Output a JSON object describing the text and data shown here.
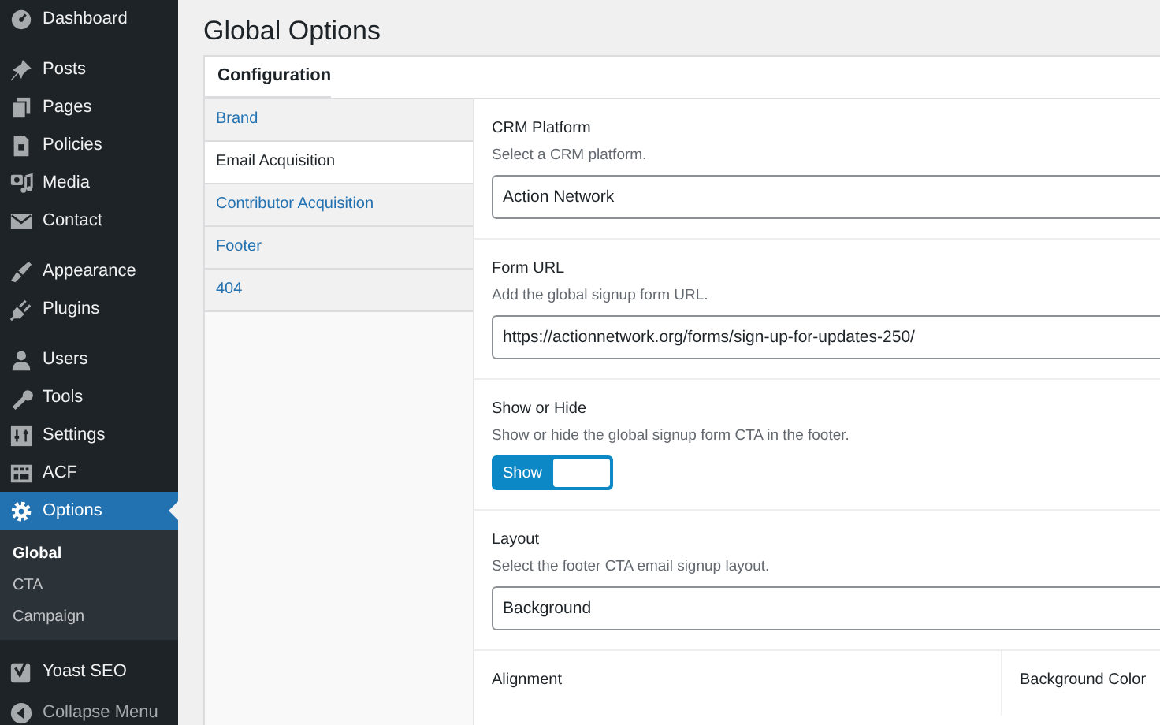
{
  "sidebar": {
    "groups": [
      [
        {
          "label": "Dashboard",
          "selected": false
        }
      ],
      [
        {
          "label": "Posts",
          "selected": false
        },
        {
          "label": "Pages",
          "selected": false
        },
        {
          "label": "Policies",
          "selected": false
        },
        {
          "label": "Media",
          "selected": false
        },
        {
          "label": "Contact",
          "selected": false
        }
      ],
      [
        {
          "label": "Appearance",
          "selected": false
        },
        {
          "label": "Plugins",
          "selected": false
        }
      ],
      [
        {
          "label": "Users",
          "selected": false
        },
        {
          "label": "Tools",
          "selected": false
        },
        {
          "label": "Settings",
          "selected": false
        },
        {
          "label": "ACF",
          "selected": false
        },
        {
          "label": "Options",
          "selected": true,
          "children": [
            {
              "label": "Global",
              "selected": true
            },
            {
              "label": "CTA",
              "selected": false
            },
            {
              "label": "Campaign",
              "selected": false
            }
          ]
        }
      ],
      [
        {
          "label": "Yoast SEO",
          "selected": false
        }
      ]
    ],
    "collapse_label": "Collapse Menu"
  },
  "page_title": "Global Options",
  "panel": {
    "title": "Configuration",
    "tabs": [
      {
        "label": "Brand",
        "selected": false
      },
      {
        "label": "Email Acquisition",
        "selected": true
      },
      {
        "label": "Contributor Acquisition",
        "selected": false
      },
      {
        "label": "Footer",
        "selected": false
      },
      {
        "label": "404",
        "selected": false
      }
    ],
    "fields": [
      {
        "kind": "select",
        "label": "CRM Platform",
        "description": "Select a CRM platform.",
        "value": "Action Network"
      },
      {
        "kind": "text",
        "label": "Form URL",
        "description": "Add the global signup form URL.",
        "value": "https://actionnetwork.org/forms/sign-up-for-updates-250/"
      },
      {
        "kind": "toggle",
        "label": "Show or Hide",
        "description": "Show or hide the global signup form CTA in the footer.",
        "on": true,
        "on_text": "Show"
      },
      {
        "kind": "select",
        "label": "Layout",
        "description": "Select the footer CTA email signup layout.",
        "value": "Background"
      },
      {
        "kind": "columns",
        "columns": [
          {
            "label": "Alignment"
          },
          {
            "label": "Background Color"
          }
        ]
      }
    ]
  }
}
